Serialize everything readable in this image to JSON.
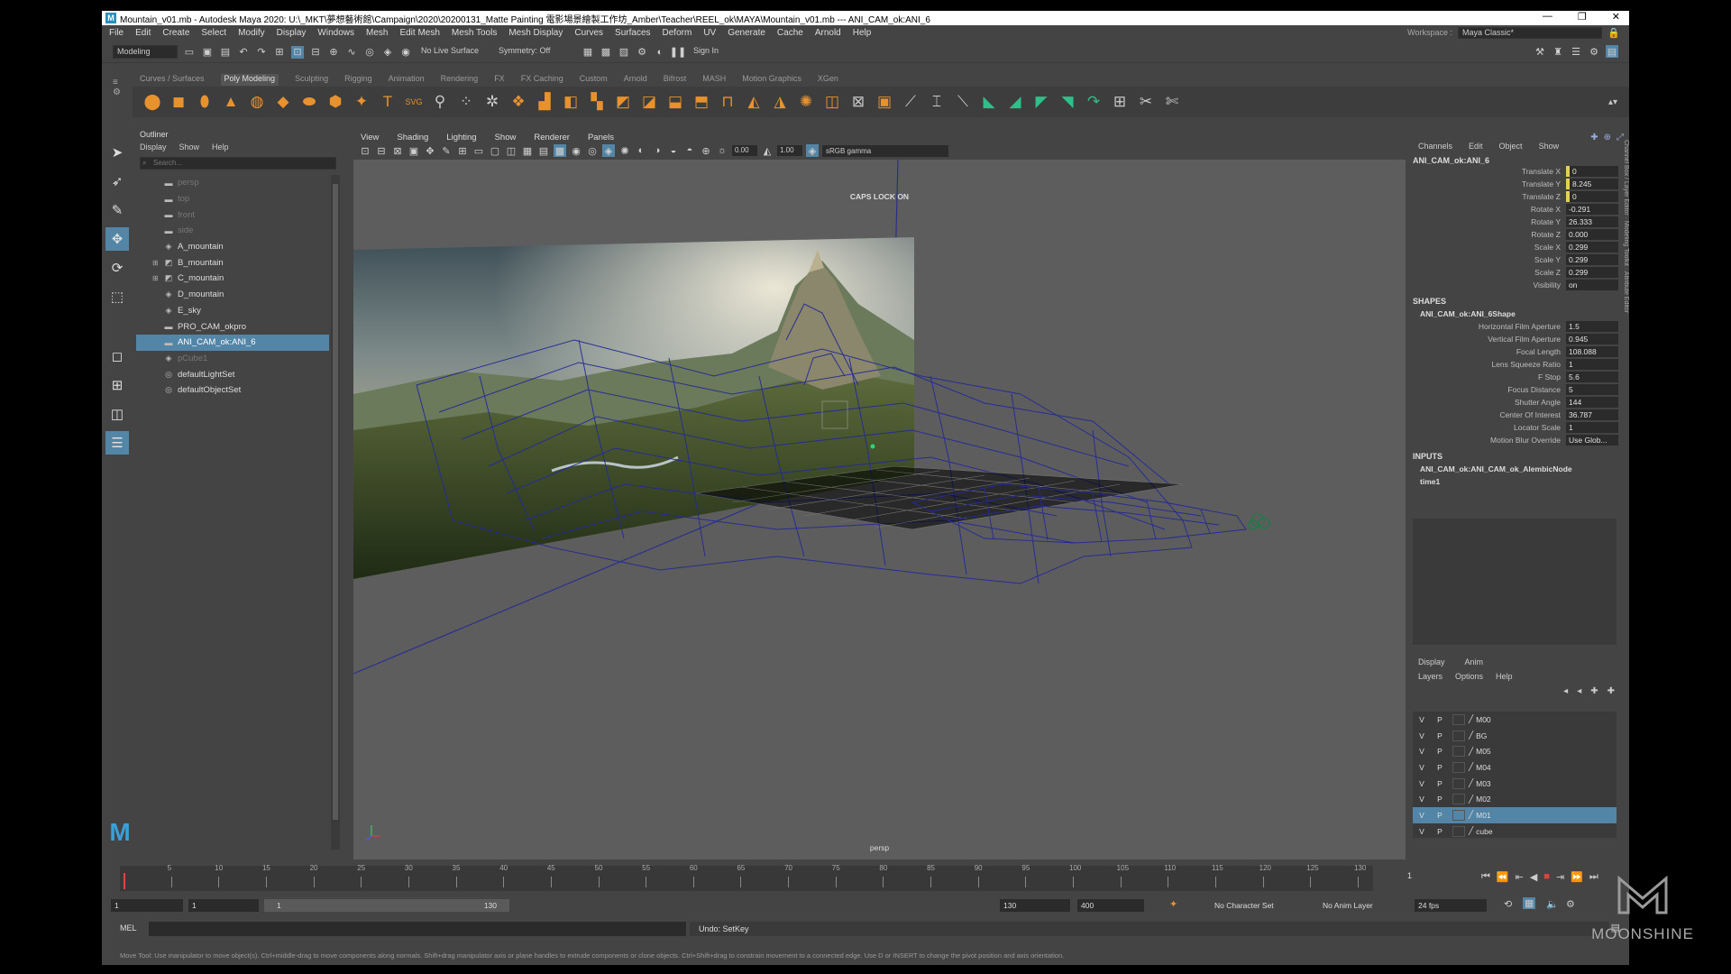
{
  "title": {
    "text": "Mountain_v01.mb - Autodesk Maya 2020: U:\\_MKT\\夢想藝術館\\Campaign\\2020\\20200131_Matte Painting 電影場景繪製工作坊_Amber\\Teacher\\REEL_ok\\MAYA\\Mountain_v01.mb  ---  ANI_CAM_ok:ANI_6",
    "minimize": "—",
    "maximize": "❐",
    "close": "✕"
  },
  "menu": [
    "File",
    "Edit",
    "Create",
    "Select",
    "Modify",
    "Display",
    "Windows",
    "Mesh",
    "Edit Mesh",
    "Mesh Tools",
    "Mesh Display",
    "Curves",
    "Surfaces",
    "Deform",
    "UV",
    "Generate",
    "Cache",
    "Arnold",
    "Help"
  ],
  "workspace": {
    "label": "Workspace :",
    "value": "Maya Classic*"
  },
  "status": {
    "mode": "Modeling",
    "live_surface": "No Live Surface",
    "symmetry": "Symmetry: Off",
    "sign_in": "Sign In"
  },
  "shelf_tabs": [
    "Curves / Surfaces",
    "Poly Modeling",
    "Sculpting",
    "Rigging",
    "Animation",
    "Rendering",
    "FX",
    "FX Caching",
    "Custom",
    "Arnold",
    "Bifrost",
    "MASH",
    "Motion Graphics",
    "XGen"
  ],
  "shelf_active": "Poly Modeling",
  "outliner": {
    "title": "Outliner",
    "menu": [
      "Display",
      "Show",
      "Help"
    ],
    "search_placeholder": "Search...",
    "items": [
      {
        "label": "persp",
        "icon": "camera-icon",
        "dim": true
      },
      {
        "label": "top",
        "icon": "camera-icon",
        "dim": true
      },
      {
        "label": "front",
        "icon": "camera-icon",
        "dim": true
      },
      {
        "label": "side",
        "icon": "camera-icon",
        "dim": true
      },
      {
        "label": "A_mountain",
        "icon": "mesh-icon",
        "dim": false
      },
      {
        "label": "B_mountain",
        "icon": "group-icon",
        "dim": false
      },
      {
        "label": "C_mountain",
        "icon": "group-icon",
        "dim": false
      },
      {
        "label": "D_mountain",
        "icon": "mesh-icon",
        "dim": false
      },
      {
        "label": "E_sky",
        "icon": "mesh-icon",
        "dim": false
      },
      {
        "label": "PRO_CAM_okpro",
        "icon": "camera-icon",
        "dim": false
      },
      {
        "label": "ANI_CAM_ok:ANI_6",
        "icon": "camera-icon",
        "dim": false,
        "selected": true
      },
      {
        "label": "pCube1",
        "icon": "mesh-icon",
        "dim": true
      },
      {
        "label": "defaultLightSet",
        "icon": "set-icon",
        "dim": false
      },
      {
        "label": "defaultObjectSet",
        "icon": "set-icon",
        "dim": false
      }
    ]
  },
  "viewport": {
    "menu": [
      "View",
      "Shading",
      "Lighting",
      "Show",
      "Renderer",
      "Panels"
    ],
    "field1": "0.00",
    "field2": "1.00",
    "color_space": "sRGB gamma",
    "caps_lock": "CAPS LOCK ON",
    "camera_label": "persp"
  },
  "channel_box": {
    "tabs": [
      "Channels",
      "Edit",
      "Object",
      "Show"
    ],
    "node": "ANI_CAM_ok:ANI_6",
    "attributes": [
      {
        "label": "Translate X",
        "value": "0",
        "keyed": true
      },
      {
        "label": "Translate Y",
        "value": "8.245",
        "keyed": true
      },
      {
        "label": "Translate Z",
        "value": "0",
        "keyed": true
      },
      {
        "label": "Rotate X",
        "value": "-0.291",
        "keyed": false
      },
      {
        "label": "Rotate Y",
        "value": "26.333",
        "keyed": false
      },
      {
        "label": "Rotate Z",
        "value": "0.000",
        "keyed": false
      },
      {
        "label": "Scale X",
        "value": "0.299",
        "keyed": false
      },
      {
        "label": "Scale Y",
        "value": "0.299",
        "keyed": false
      },
      {
        "label": "Scale Z",
        "value": "0.299",
        "keyed": false
      },
      {
        "label": "Visibility",
        "value": "on",
        "keyed": false
      }
    ],
    "shapes_title": "SHAPES",
    "shape_node": "ANI_CAM_ok:ANI_6Shape",
    "shape_attributes": [
      {
        "label": "Horizontal Film Aperture",
        "value": "1.5"
      },
      {
        "label": "Vertical Film Aperture",
        "value": "0.945"
      },
      {
        "label": "Focal Length",
        "value": "108.088"
      },
      {
        "label": "Lens Squeeze Ratio",
        "value": "1"
      },
      {
        "label": "F Stop",
        "value": "5.6"
      },
      {
        "label": "Focus Distance",
        "value": "5"
      },
      {
        "label": "Shutter Angle",
        "value": "144"
      },
      {
        "label": "Center Of Interest",
        "value": "36.787"
      },
      {
        "label": "Locator Scale",
        "value": "1"
      },
      {
        "label": "Motion Blur Override",
        "value": "Use Glob..."
      }
    ],
    "inputs_title": "INPUTS",
    "inputs": [
      "ANI_CAM_ok:ANI_CAM_ok_AlembicNode",
      "time1"
    ]
  },
  "layer_editor": {
    "tabs": [
      "Display",
      "Anim"
    ],
    "menu": [
      "Layers",
      "Options",
      "Help"
    ],
    "layers": [
      {
        "name": "M00"
      },
      {
        "name": "BG"
      },
      {
        "name": "M05"
      },
      {
        "name": "M04"
      },
      {
        "name": "M03"
      },
      {
        "name": "M02"
      },
      {
        "name": "M01",
        "selected": true
      },
      {
        "name": "cube"
      }
    ],
    "v": "V",
    "p": "P"
  },
  "timeline": {
    "ticks": [
      "5",
      "10",
      "15",
      "20",
      "25",
      "30",
      "35",
      "40",
      "45",
      "50",
      "55",
      "60",
      "65",
      "70",
      "75",
      "80",
      "85",
      "90",
      "95",
      "100",
      "105",
      "110",
      "115",
      "120",
      "125",
      "130"
    ],
    "current_frame": "1"
  },
  "range": {
    "start": "1",
    "playback_start": "1",
    "slider_start": "1",
    "slider_end": "130",
    "playback_end": "130",
    "end": "400",
    "character_set": "No Character Set",
    "anim_layer": "No Anim Layer",
    "fps": "24 fps"
  },
  "command": {
    "label": "MEL",
    "result": "Undo: SetKey"
  },
  "help_line": "Move Tool: Use manipulator to move object(s). Ctrl+middle-drag to move components along normals. Shift+drag manipulator axis or plane handles to extrude components or clone objects. Ctrl+Shift+drag to constrain movement to a connected edge. Use D or INSERT to change the pivot position and axis orientation.",
  "watermark": "MOONSHINE"
}
